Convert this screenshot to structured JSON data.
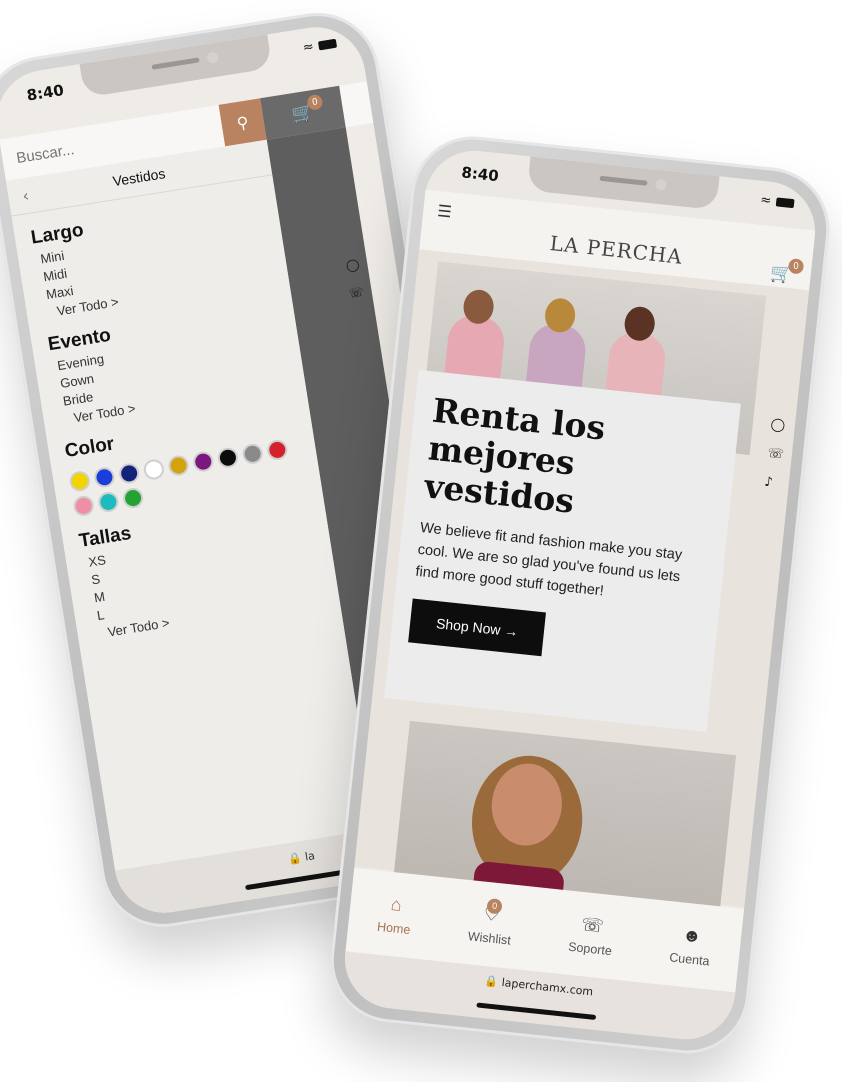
{
  "back_phone": {
    "status_time": "8:40",
    "search": {
      "placeholder": "Buscar..."
    },
    "cart_count": "0",
    "menu": {
      "title": "Vestidos",
      "sections": {
        "largo": {
          "title": "Largo",
          "items": [
            "Mini",
            "Midi",
            "Maxi"
          ],
          "more": "Ver Todo >"
        },
        "evento": {
          "title": "Evento",
          "items": [
            "Evening",
            "Gown",
            "Bride"
          ],
          "more": "Ver Todo >"
        },
        "color": {
          "title": "Color",
          "swatches": [
            "#f2d500",
            "#1c3dd9",
            "#14237a",
            "#ffffff",
            "#d4a20f",
            "#7c177e",
            "#0c0c0c",
            "#8a8a8a",
            "#d3222b",
            "#ee8fa6",
            "#1cbcbc",
            "#23a334"
          ]
        },
        "tallas": {
          "title": "Tallas",
          "items": [
            "XS",
            "S",
            "M",
            "L"
          ],
          "more": "Ver Todo >"
        }
      }
    },
    "url": "la"
  },
  "front_phone": {
    "status_time": "8:40",
    "logo": "LA PERCHA",
    "cart_count": "0",
    "hero": {
      "title": "Renta los mejores vestidos",
      "text": "We believe fit and fashion make you stay cool. We are so glad you've found us lets find more good stuff together!",
      "button": "Shop Now →"
    },
    "tabs": {
      "home": "Home",
      "wishlist": "Wishlist",
      "wishlist_count": "0",
      "support": "Soporte",
      "account": "Cuenta"
    },
    "url": "laperchamx.com"
  }
}
